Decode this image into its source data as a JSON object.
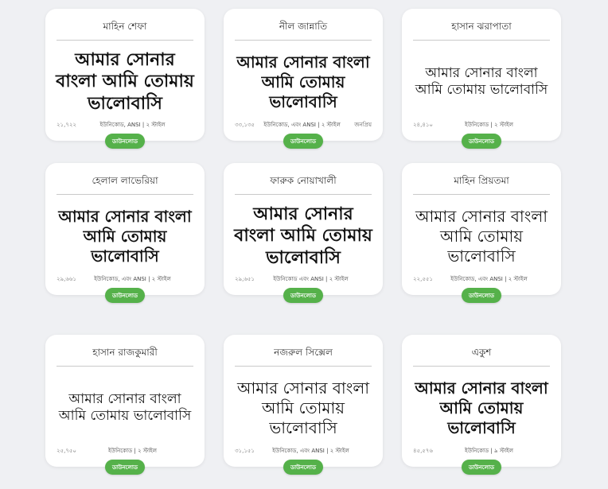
{
  "cards": [
    {
      "name": "মাহিন শেফা",
      "sample": "আমার সোনার বাংলা আমি তোমায় ভালোবাসি",
      "count": "২১,৭২২",
      "license": "ইউনিকোড, ANSI | ২ স্টাইল",
      "extra": "",
      "cta": "ডাউনলোড"
    },
    {
      "name": "নীল জান্নাতি",
      "sample": "আমার সোনার বাংলা আমি তোমায় ভালোবাসি",
      "count": "৩৩,১৩৫",
      "license": "ইউনিকোড, এবং ANSI | ২ স্টাইল",
      "extra": "জনপ্রিয়",
      "cta": "ডাউনলোড"
    },
    {
      "name": "হাসান ঝরাপাতা",
      "sample": "আমার সোনার বাংলা আমি তোমায় ভালোবাসি",
      "count": "২৪,৪১০",
      "license": "ইউনিকোড | ২ স্টাইল",
      "extra": "",
      "cta": "ডাউনলোড"
    },
    {
      "name": "হেলাল লাভেরিয়া",
      "sample": "আমার সোনার বাংলা আমি তোমায় ভালোবাসি",
      "count": "২৯,৬৬১",
      "license": "ইউনিকোড, এবং ANSI | ২ স্টাইল",
      "extra": "",
      "cta": "ডাউনলোড"
    },
    {
      "name": "ফারুক নোয়াখালী",
      "sample": "আমার সোনার বাংলা আমি তোমায় ভালোবাসি",
      "count": "২৯,৬৫১",
      "license": "ইউনিকোড এবং ANSI | ২ স্টাইল",
      "extra": "",
      "cta": "ডাউনলোড"
    },
    {
      "name": "মাহিন প্রিয়তমা",
      "sample": "আমার সোনার বাংলা আমি তোমায় ভালোবাসি",
      "count": "২২,৫৫১",
      "license": "ইউনিকোড, এবং ANSI | ২ স্টাইল",
      "extra": "",
      "cta": "ডাউনলোড"
    },
    {
      "name": "হাসান রাজকুমারী",
      "sample": "আমার সোনার বাংলা আমি তোমায় ভালোবাসি",
      "count": "২৫,৭৫০",
      "license": "ইউনিকোড | ২ স্টাইল",
      "extra": "",
      "cta": "ডাউনলোড"
    },
    {
      "name": "নজরুল সিক্সেল",
      "sample": "আমার সোনার বাংলা আমি তোমায় ভালোবাসি",
      "count": "৩১,১৫১",
      "license": "ইউনিকোড, এবং ANSI | ২ স্টাইল",
      "extra": "",
      "cta": "ডাউনলোড"
    },
    {
      "name": "একুশ",
      "sample": "আমার সোনার বাংলা আমি তোমায় ভালোবাসি",
      "count": "৪৫,৫৭৬",
      "license": "ইউনিকোড | ৯ স্টাইল",
      "extra": "",
      "cta": "ডাউনলোড"
    }
  ],
  "colors": {
    "accent": "#55b14a",
    "card": "#ffffff",
    "background": "#eff0f3"
  }
}
